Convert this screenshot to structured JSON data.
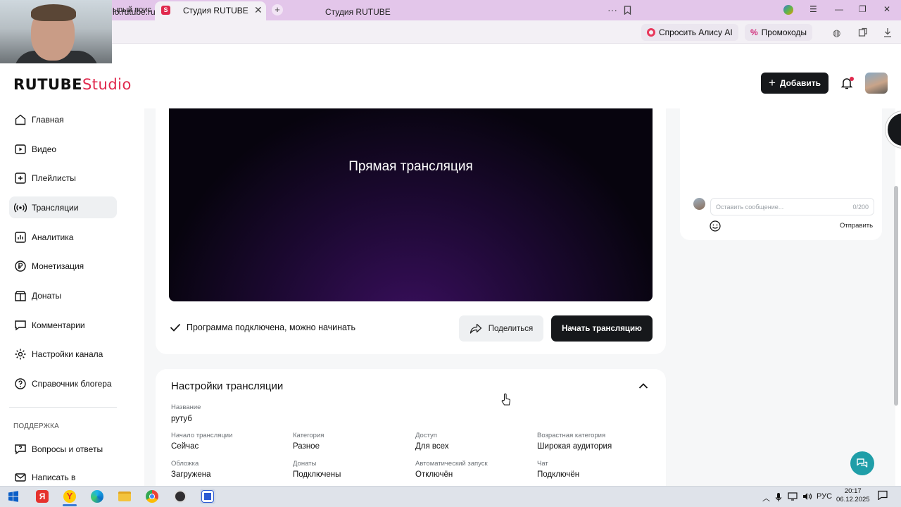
{
  "browser": {
    "prev_tab_text": "ырый поис",
    "active_tab_title": "Студия RUTUBE",
    "tab_close": "✕",
    "new_tab": "+",
    "url": "io.rutube.ru",
    "page_title": "Студия RUTUBE",
    "more": "···",
    "alice_label": "Спросить Алису AI",
    "promo_label": "Промокоды"
  },
  "app": {
    "logo_main": "RUTUBE",
    "logo_suffix": "Studio",
    "add_label": "Добавить"
  },
  "sidebar": {
    "items": [
      {
        "label": "Главная",
        "icon": "home-icon"
      },
      {
        "label": "Видео",
        "icon": "video-icon"
      },
      {
        "label": "Плейлисты",
        "icon": "playlist-icon"
      },
      {
        "label": "Трансляции",
        "icon": "broadcast-icon",
        "active": true
      },
      {
        "label": "Аналитика",
        "icon": "analytics-icon"
      },
      {
        "label": "Монетизация",
        "icon": "ruble-icon"
      },
      {
        "label": "Донаты",
        "icon": "donate-icon"
      },
      {
        "label": "Комментарии",
        "icon": "comments-icon"
      },
      {
        "label": "Настройки канала",
        "icon": "gear-icon"
      },
      {
        "label": "Справочник блогера",
        "icon": "help-circle-icon"
      }
    ],
    "support_title": "ПОДДЕРЖКА",
    "support_items": [
      {
        "label": "Вопросы и ответы",
        "icon": "faq-icon"
      },
      {
        "label": "Написать в",
        "icon": "mail-icon"
      }
    ]
  },
  "stream": {
    "player_title": "Прямая трансляция",
    "status_text": "Программа подключена, можно начинать",
    "share_label": "Поделиться",
    "start_label": "Начать трансляцию"
  },
  "chat": {
    "placeholder": "Оставить сообщение...",
    "counter": "0/200",
    "send_label": "Отправить"
  },
  "settings": {
    "title": "Настройки трансляции",
    "name_label": "Название",
    "name_value": "рутуб",
    "fields": [
      {
        "label": "Начало трансляции",
        "value": "Сейчас"
      },
      {
        "label": "Категория",
        "value": "Разное"
      },
      {
        "label": "Доступ",
        "value": "Для всех"
      },
      {
        "label": "Возрастная категория",
        "value": "Широкая аудитория"
      },
      {
        "label": "Обложка",
        "value": "Загружена"
      },
      {
        "label": "Донаты",
        "value": "Подключены"
      },
      {
        "label": "Автоматический запуск",
        "value": "Отключён"
      },
      {
        "label": "Чат",
        "value": "Подключён"
      }
    ]
  },
  "taskbar": {
    "lang": "РУС",
    "time": "20:17",
    "date": "06.12.2025"
  },
  "colors": {
    "accent": "#e0294d",
    "dark_button": "#16181b",
    "tab_bar": "#e3c6ea",
    "help_fab": "#1f9ea8"
  }
}
